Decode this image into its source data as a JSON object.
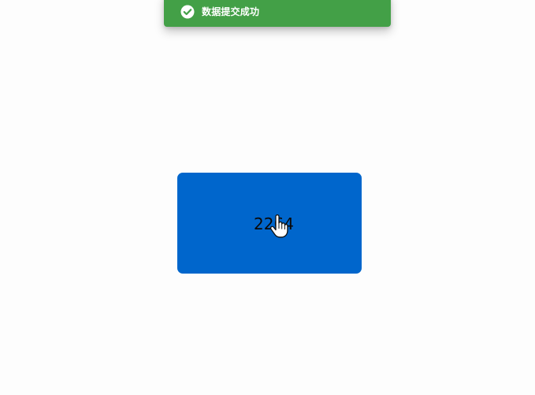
{
  "toast": {
    "icon": "check-circle-icon",
    "message": "数据提交成功",
    "color": "#43a047"
  },
  "button": {
    "label": "2264",
    "color": "#0066cc"
  },
  "cursor": {
    "icon": "hand-pointer-icon"
  },
  "page": {
    "background": "#fdfdfd"
  }
}
